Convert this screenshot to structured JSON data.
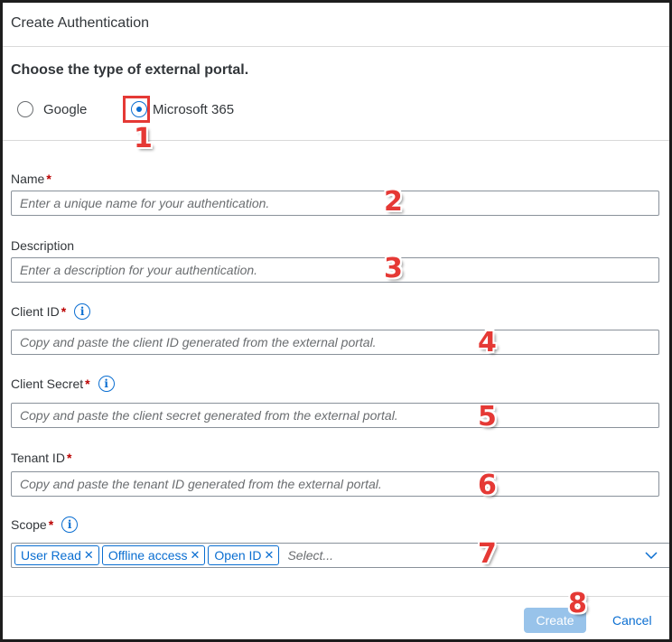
{
  "dialog": {
    "title": "Create Authentication",
    "section_title": "Choose the type of external portal.",
    "portal_options": [
      {
        "label": "Google",
        "selected": false
      },
      {
        "label": "Microsoft 365",
        "selected": true
      }
    ]
  },
  "fields": {
    "name": {
      "label": "Name",
      "required": "*",
      "placeholder": "Enter a unique name for your authentication."
    },
    "description": {
      "label": "Description",
      "placeholder": "Enter a description for your authentication."
    },
    "client_id": {
      "label": "Client ID",
      "required": "*",
      "placeholder": "Copy and paste the client ID generated from the external portal."
    },
    "client_secret": {
      "label": "Client Secret",
      "required": "*",
      "placeholder": "Copy and paste the client secret generated from the external portal."
    },
    "tenant_id": {
      "label": "Tenant ID",
      "required": "*",
      "placeholder": "Copy and paste the tenant ID generated from the external portal."
    },
    "scope": {
      "label": "Scope",
      "required": "*",
      "tokens": [
        "User Read",
        "Offline access",
        "Open ID"
      ],
      "token_remove_glyph": "✕",
      "placeholder": "Select..."
    }
  },
  "info_icon_glyph": "i",
  "footer": {
    "create_label": "Create",
    "cancel_label": "Cancel"
  },
  "annotations": [
    "1",
    "2",
    "3",
    "4",
    "5",
    "6",
    "7",
    "8"
  ],
  "colors": {
    "accent": "#0a6ed1",
    "required": "#bb0000",
    "annotation": "#e53935",
    "create_disabled": "#98c3ea"
  }
}
